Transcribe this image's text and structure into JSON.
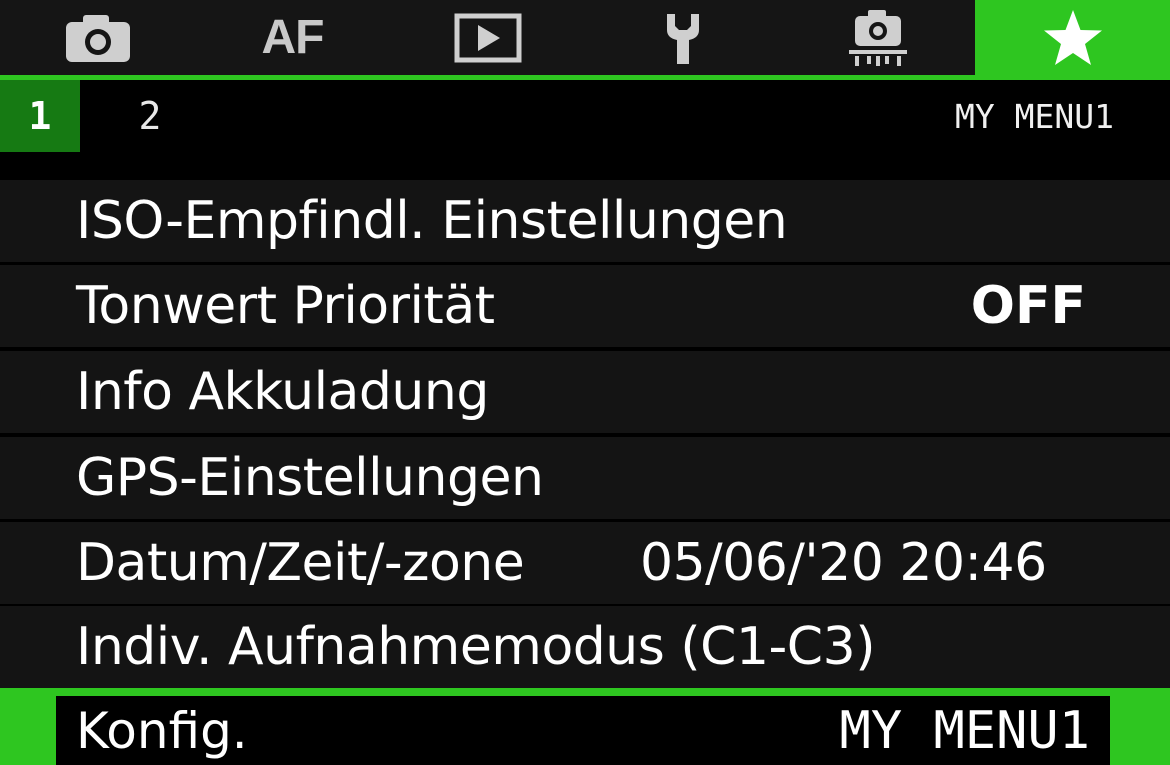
{
  "tabs": [
    {
      "icon": "camera-icon"
    },
    {
      "label": "AF"
    },
    {
      "icon": "playback-icon"
    },
    {
      "icon": "wrench-icon"
    },
    {
      "icon": "custom-function-camera-icon"
    },
    {
      "icon": "star-icon",
      "active": true
    }
  ],
  "subtabs": [
    "1",
    "2"
  ],
  "active_subtab": "1",
  "menu_caption": "MY MENU1",
  "items": [
    {
      "label": "ISO-Empfindl. Einstellungen",
      "value": ""
    },
    {
      "label": "Tonwert Priorität",
      "value": "OFF"
    },
    {
      "label": "Info Akkuladung",
      "value": ""
    },
    {
      "label": "GPS-Einstellungen",
      "value": ""
    },
    {
      "label": "Datum/Zeit/-zone",
      "value": "05/06/'20 20:46"
    },
    {
      "label": "Indiv. Aufnahmemodus (C1-C3)",
      "value": ""
    }
  ],
  "selected": {
    "label": "Konfig.",
    "value": "MY MENU1"
  },
  "colors": {
    "accent": "#2ec620",
    "accent_dark": "#167a13",
    "row_bg": "#141414"
  }
}
